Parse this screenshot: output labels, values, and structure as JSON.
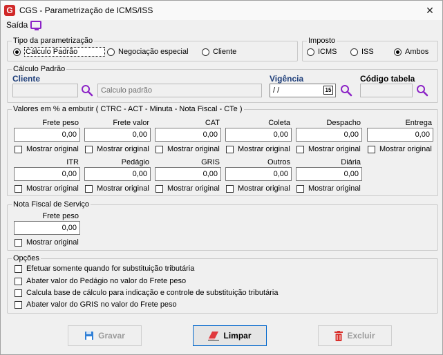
{
  "window": {
    "title": "CGS - Parametrização de ICMS/ISS",
    "close_glyph": "✕",
    "logo_letter": "G"
  },
  "menu": {
    "saida": "Saída"
  },
  "tipo": {
    "legend": "Tipo da parametrização",
    "options": [
      "Cálculo Padrão",
      "Negociação especial",
      "Cliente"
    ],
    "selected": "Cálculo Padrão"
  },
  "imposto": {
    "legend": "Imposto",
    "options": [
      "ICMS",
      "ISS",
      "Ambos"
    ],
    "selected": "Ambos"
  },
  "calculo": {
    "legend": "Cálculo Padrão",
    "cliente_label": "Cliente",
    "cliente_code": "",
    "cliente_name": "Calculo padrão",
    "vigencia_label": "Vigência",
    "vigencia_value": " / /",
    "calendar_glyph": "15",
    "codigo_label": "Código tabela",
    "codigo_value": ""
  },
  "valores": {
    "legend": "Valores em % a embutir ( CTRC - ACT -  Minuta - Nota Fiscal -  CTe )",
    "mostrar_label": "Mostrar original",
    "row1": [
      {
        "label": "Frete peso",
        "value": "0,00"
      },
      {
        "label": "Frete valor",
        "value": "0,00"
      },
      {
        "label": "CAT",
        "value": "0,00"
      },
      {
        "label": "Coleta",
        "value": "0,00"
      },
      {
        "label": "Despacho",
        "value": "0,00"
      },
      {
        "label": "Entrega",
        "value": "0,00"
      }
    ],
    "row2": [
      {
        "label": "ITR",
        "value": "0,00"
      },
      {
        "label": "Pedágio",
        "value": "0,00"
      },
      {
        "label": "GRIS",
        "value": "0,00"
      },
      {
        "label": "Outros",
        "value": "0,00"
      },
      {
        "label": "Diária",
        "value": "0,00"
      }
    ]
  },
  "nota": {
    "legend": "Nota Fiscal de Serviço",
    "label": "Frete peso",
    "value": "0,00",
    "mostrar_label": "Mostrar original"
  },
  "opcoes": {
    "legend": "Opções",
    "items": [
      "Efetuar somente quando for substituição tributária",
      "Abater valor do Pedágio no valor do Frete peso",
      "Calcula base de cálculo para indicação e controle de substituição tributária",
      "Abater valor do GRIS no valor do Frete peso"
    ]
  },
  "buttons": {
    "gravar": "Gravar",
    "limpar": "Limpar",
    "excluir": "Excluir"
  },
  "colors": {
    "accent": "#8b22c6",
    "heading_blue": "#1f3f7a",
    "delete_red": "#d9302c",
    "save_blue": "#2f7fd6"
  }
}
